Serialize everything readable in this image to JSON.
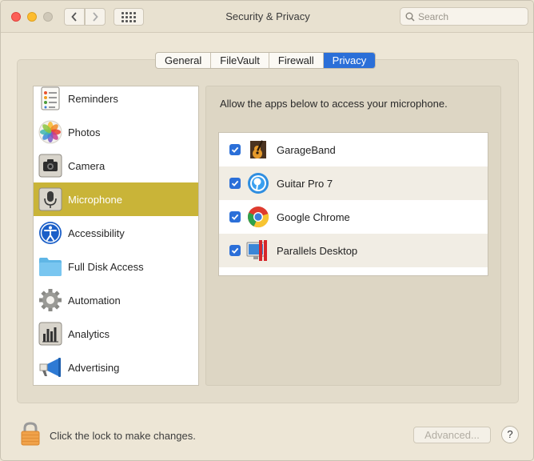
{
  "window": {
    "title": "Security & Privacy"
  },
  "search": {
    "placeholder": "Search"
  },
  "tabs": [
    {
      "label": "General"
    },
    {
      "label": "FileVault"
    },
    {
      "label": "Firewall"
    },
    {
      "label": "Privacy",
      "active": true
    }
  ],
  "sidebar": {
    "items": [
      {
        "label": "Reminders",
        "icon": "reminders-icon"
      },
      {
        "label": "Photos",
        "icon": "photos-icon"
      },
      {
        "label": "Camera",
        "icon": "camera-icon"
      },
      {
        "label": "Microphone",
        "icon": "microphone-icon",
        "selected": true
      },
      {
        "label": "Accessibility",
        "icon": "accessibility-icon"
      },
      {
        "label": "Full Disk Access",
        "icon": "folder-icon"
      },
      {
        "label": "Automation",
        "icon": "gear-icon"
      },
      {
        "label": "Analytics",
        "icon": "analytics-icon"
      },
      {
        "label": "Advertising",
        "icon": "megaphone-icon"
      }
    ]
  },
  "panel": {
    "description": "Allow the apps below to access your microphone.",
    "apps": [
      {
        "name": "GarageBand",
        "checked": true,
        "icon": "garageband-icon"
      },
      {
        "name": "Guitar Pro 7",
        "checked": true,
        "icon": "guitar-pro-icon"
      },
      {
        "name": "Google Chrome",
        "checked": true,
        "icon": "chrome-icon"
      },
      {
        "name": "Parallels Desktop",
        "checked": true,
        "icon": "parallels-icon"
      }
    ]
  },
  "footer": {
    "lock_text": "Click the lock to make changes.",
    "advanced_label": "Advanced...",
    "help_label": "?"
  },
  "colors": {
    "accent": "#2b6fd8",
    "selection": "#c9b438",
    "window_bg": "#ede6d6"
  }
}
